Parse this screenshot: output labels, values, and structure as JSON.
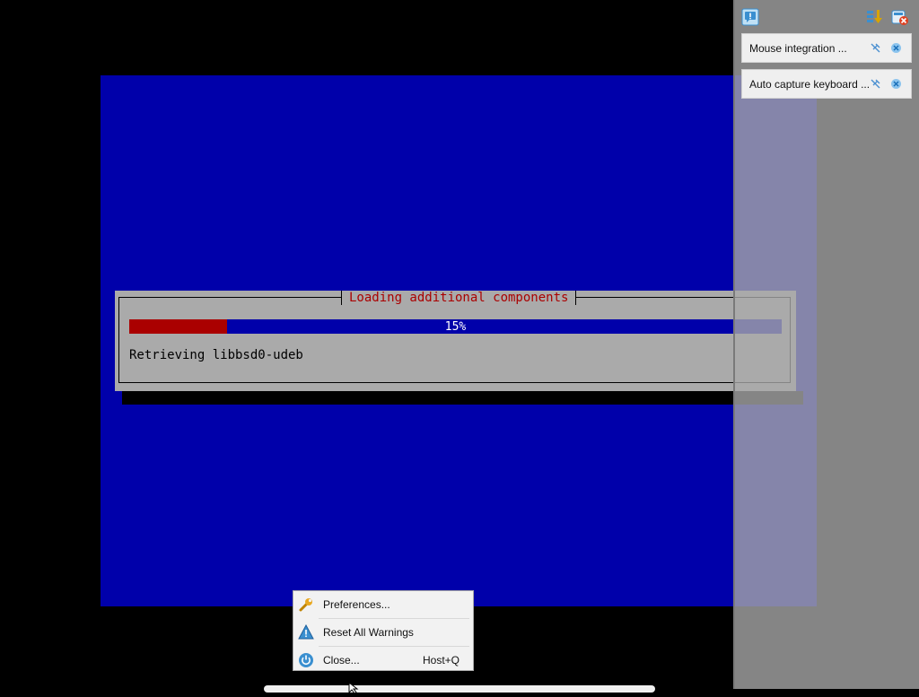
{
  "installer": {
    "title": "Loading additional components",
    "progress_fraction": 0.15,
    "progress_label": "15%",
    "status": "Retrieving libbsd0-udeb"
  },
  "notifications": {
    "top_icons": [
      "message-icon",
      "collapse-icon",
      "close-all-icon"
    ],
    "items": [
      {
        "text": "Mouse integration ...",
        "icons": [
          "pin-icon",
          "close-icon"
        ]
      },
      {
        "text": "Auto capture keyboard ...",
        "icons": [
          "pin-icon",
          "close-icon"
        ]
      }
    ]
  },
  "menu": {
    "items": [
      {
        "label": "Preferences...",
        "shortcut": "",
        "icon": "wrench-icon"
      },
      {
        "label": "Reset All Warnings",
        "shortcut": "",
        "icon": "warning-icon"
      },
      {
        "label": "Close...",
        "shortcut": "Host+Q",
        "icon": "power-icon"
      }
    ]
  },
  "colors": {
    "guest_background": "#0000aa",
    "dialog_background": "#aaaaaa",
    "progress_fill": "#aa0000",
    "title_text": "#aa0000"
  }
}
